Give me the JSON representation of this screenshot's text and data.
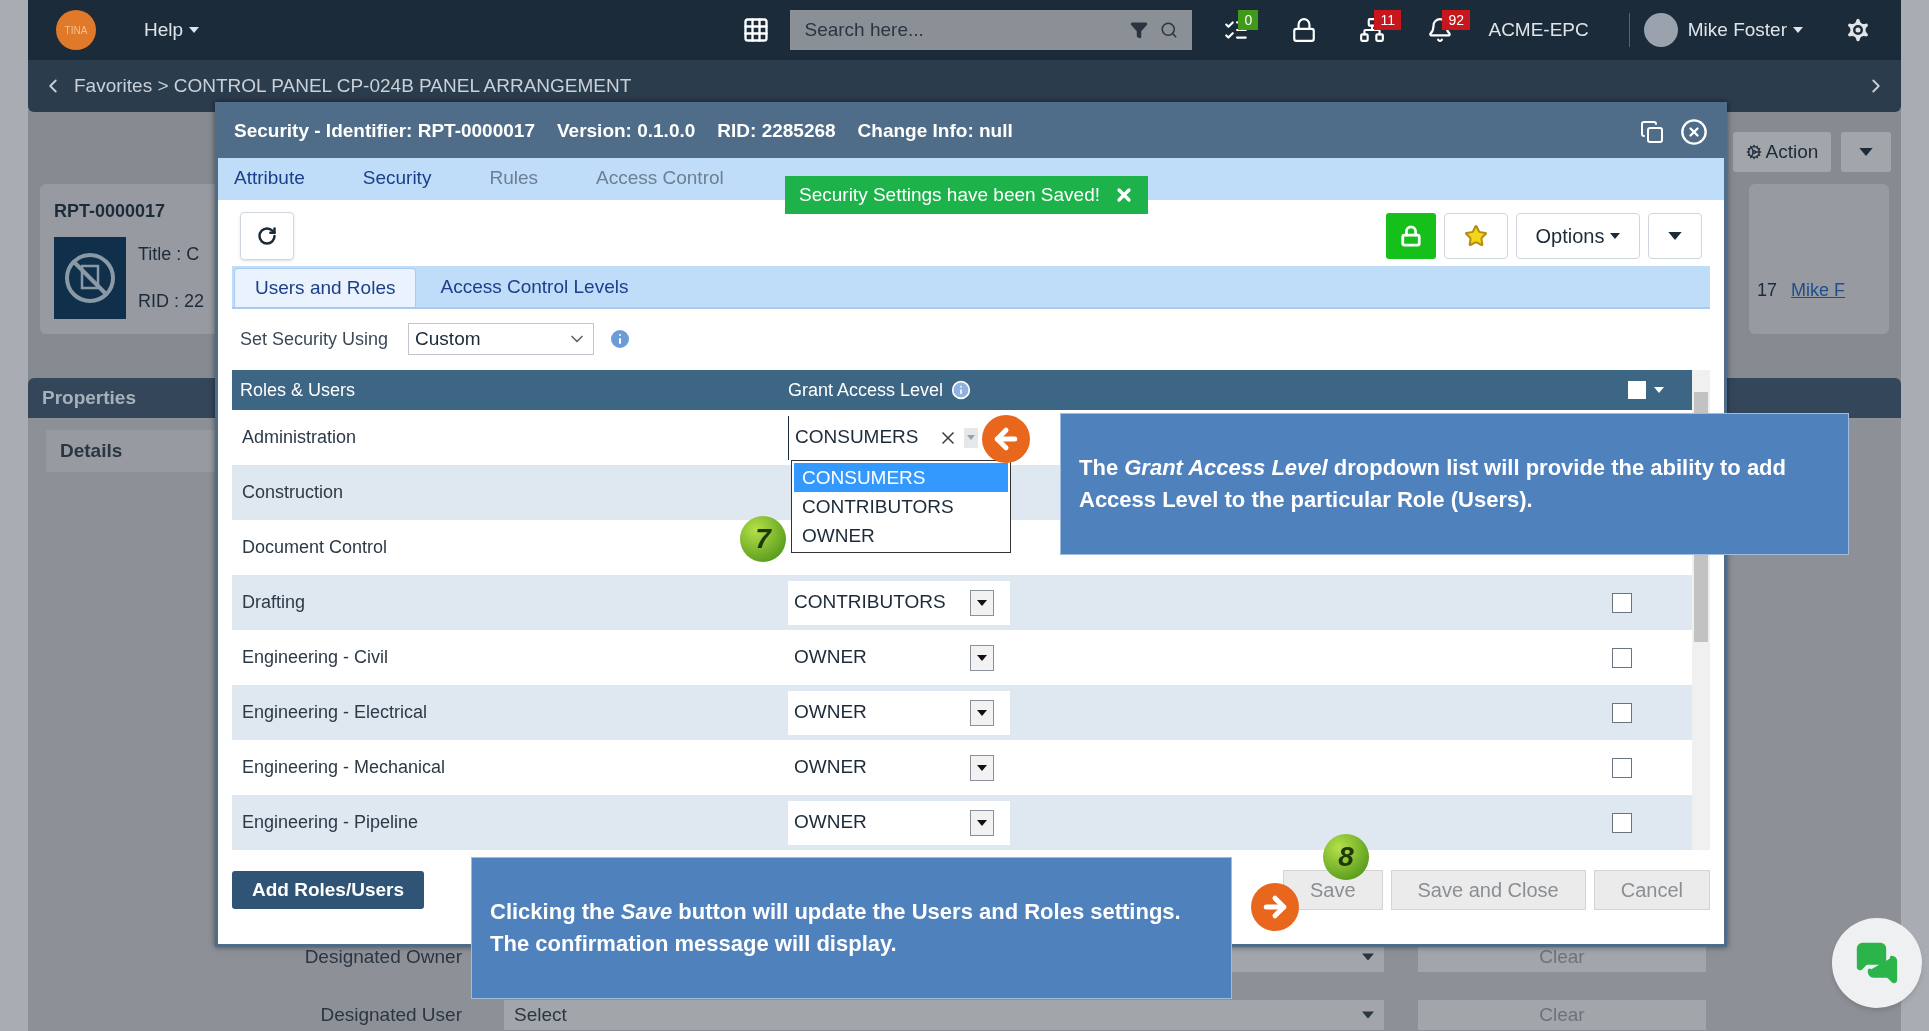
{
  "navbar": {
    "logo": "TINA",
    "help": "Help",
    "search": {
      "placeholder": "Search here..."
    },
    "indicators": [
      {
        "kind": "tasks",
        "count": "0",
        "color": "#3f9a1c"
      },
      {
        "kind": "lock"
      },
      {
        "kind": "hierarchy",
        "count": "11",
        "color": "#c8161d"
      },
      {
        "kind": "bell",
        "count": "92",
        "color": "#c8161d"
      }
    ],
    "company": "ACME-EPC",
    "user": "Mike Foster"
  },
  "breadcrumb": "Favorites > CONTROL PANEL CP-024B PANEL ARRANGEMENT",
  "background": {
    "card": {
      "id": "RPT-0000017",
      "title_label": "Title :",
      "title_value": "C",
      "rid_label": "RID :",
      "rid_value": "22"
    },
    "action_button": "Action",
    "date_fragment": "17",
    "owner_link": "Mike F",
    "properties": "Properties",
    "details_tab": "Details",
    "fields": [
      {
        "label": "Designated Owner",
        "clear": "Clear"
      },
      {
        "label": "Designated User",
        "value": "Select",
        "clear": "Clear"
      }
    ]
  },
  "modal": {
    "title_parts": [
      "Security - Identifier: RPT-0000017",
      "Version: 0.1.0.0",
      "RID: 2285268",
      "Change Info: null"
    ],
    "tabs": [
      {
        "label": "Attribute",
        "disabled": false
      },
      {
        "label": "Security",
        "disabled": false
      },
      {
        "label": "Rules",
        "disabled": true
      },
      {
        "label": "Access Control",
        "disabled": true
      }
    ],
    "toast": "Security Settings have been Saved!",
    "options": "Options",
    "subtabs": [
      {
        "label": "Users and Roles",
        "selected": true
      },
      {
        "label": "Access Control Levels",
        "selected": false
      }
    ],
    "set_security": {
      "label": "Set Security Using",
      "value": "Custom"
    },
    "table": {
      "columns": [
        "Roles & Users",
        "Grant Access Level"
      ],
      "select_all_checked": false,
      "rows": [
        {
          "name": "Administration",
          "access": "CONSUMERS",
          "editing": true
        },
        {
          "name": "Construction"
        },
        {
          "name": "Document Control"
        },
        {
          "name": "Drafting",
          "access": "CONTRIBUTORS",
          "checked": false
        },
        {
          "name": "Engineering - Civil",
          "access": "OWNER",
          "checked": false
        },
        {
          "name": "Engineering - Electrical",
          "access": "OWNER",
          "checked": false
        },
        {
          "name": "Engineering - Mechanical",
          "access": "OWNER",
          "checked": false
        },
        {
          "name": "Engineering - Pipeline",
          "access": "OWNER",
          "checked": false
        }
      ]
    },
    "dropdown": [
      {
        "label": "CONSUMERS",
        "selected": true
      },
      {
        "label": "CONTRIBUTORS",
        "selected": false
      },
      {
        "label": "OWNER",
        "selected": false
      }
    ],
    "add_button": "Add Roles/Users",
    "buttons": [
      "Save",
      "Save and Close",
      "Cancel"
    ]
  },
  "callouts": [
    "The *Grant Access Level* dropdown list will provide the ability to add Access Level to the particular Role (Users).",
    "Clicking the *Save* button will update the Users and Roles settings. The confirmation message will display."
  ],
  "steps": [
    "7",
    "8"
  ]
}
